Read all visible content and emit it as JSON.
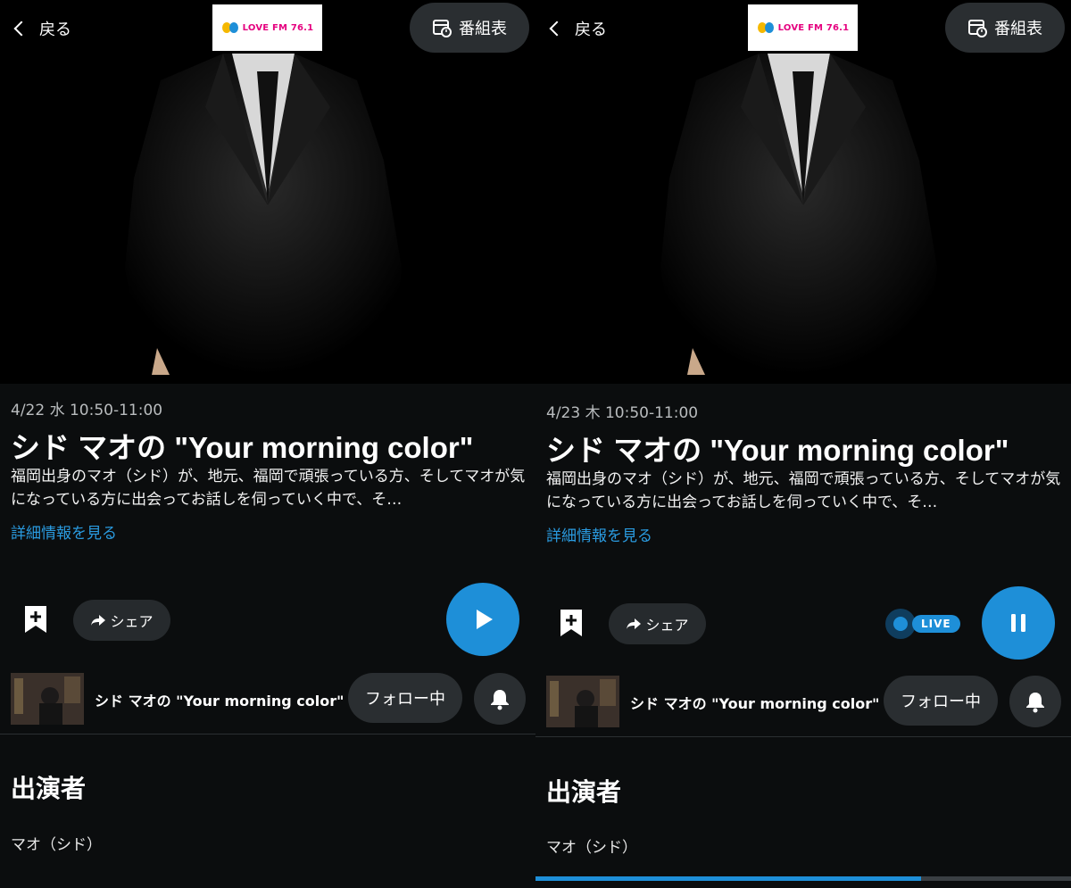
{
  "colors": {
    "accent": "#1e8fd8",
    "logo_pink": "#e5007f",
    "chip_bg": "#2a2e31"
  },
  "header": {
    "back_label": "戻る",
    "logo_text": "LOVE FM 76.1",
    "schedule_label": "番組表"
  },
  "panels": [
    {
      "date": "4/22 水 10:50-11:00",
      "title": "シド マオの \"Your morning color\"",
      "description": "福岡出身のマオ（シド）が、地元、福岡で頑張っている方、そしてマオが気になっている方に出会ってお話しを伺っていく中で、そ…",
      "more_label": "詳細情報を見る",
      "share_label": "シェア",
      "play_state": "play",
      "program_name": "シド マオの \"Your morning color\"",
      "follow_label": "フォロー中",
      "section_title": "出演者",
      "cast_name": "マオ（シド）"
    },
    {
      "date": "4/23 木 10:50-11:00",
      "title": "シド マオの \"Your morning color\"",
      "description": "福岡出身のマオ（シド）が、地元、福岡で頑張っている方、そしてマオが気になっている方に出会ってお話しを伺っていく中で、そ…",
      "more_label": "詳細情報を見る",
      "share_label": "シェア",
      "play_state": "pause",
      "live_label": "LIVE",
      "program_name": "シド マオの \"Your morning color\"",
      "follow_label": "フォロー中",
      "section_title": "出演者",
      "cast_name": "マオ（シド）",
      "progress": 0.72
    }
  ]
}
